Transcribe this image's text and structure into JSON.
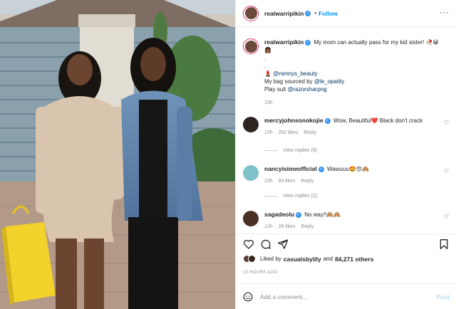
{
  "header": {
    "username": "realwarripikin",
    "follow_label": "Follow",
    "separator": "•",
    "more": "···"
  },
  "caption": {
    "username": "realwarripikin",
    "text": "My mom can actually pass for my kid sister!",
    "emojis": "🥀😀👩🏾",
    "dot1": ".",
    "dot2": ".",
    "line_makeup_prefix": "💄",
    "line_makeup_handle": "@nennys_beauty",
    "line_bag_text": "My bag sourced by",
    "line_bag_handle": "@le_opatity",
    "line_suit_text": "Play suit",
    "line_suit_handle": "@razorsharpng",
    "time": "13h"
  },
  "comments": [
    {
      "username": "mercyjohnsonokojie",
      "text": "Wow, Beautiful",
      "emoji": "❤️",
      "text2": "Black don't crack",
      "time": "12h",
      "likes": "292 likes",
      "reply": "Reply",
      "view_replies": "View replies (8)"
    },
    {
      "username": "nancyisimeofficial",
      "text": "Wawuuu",
      "emoji": "🤩😍🙈",
      "time": "13h",
      "likes": "84 likes",
      "reply": "Reply",
      "view_replies": "View replies (2)"
    },
    {
      "username": "sagadeolu",
      "text": "No way!!",
      "emoji": "🙈🙈",
      "time": "12h",
      "likes": "28 likes",
      "reply": "Reply"
    }
  ],
  "likes": {
    "prefix": "Liked by",
    "user": "casualsbylily",
    "mid": "and",
    "count": "84,271 others"
  },
  "time_ago": "13 HOURS AGO",
  "add_comment": {
    "placeholder": "Add a comment...",
    "post_label": "Post"
  },
  "colors": {
    "accent": "#0095f6",
    "verified": "#3897f0",
    "ring": "#e1306c"
  }
}
